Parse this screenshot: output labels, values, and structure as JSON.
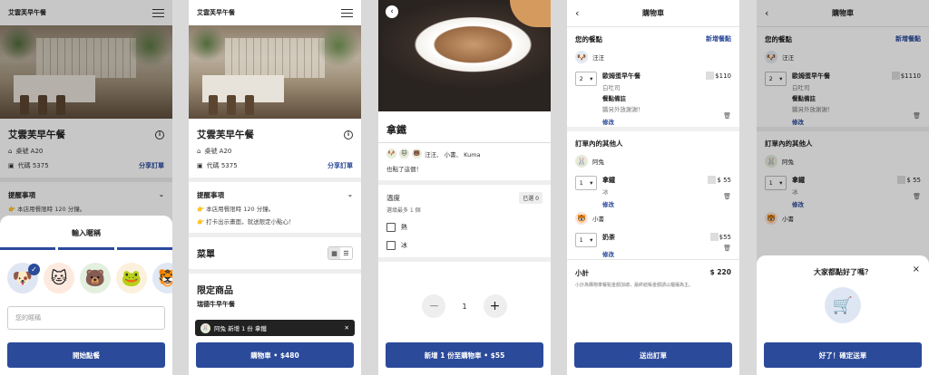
{
  "brand": "艾雲芙早午餐",
  "store": {
    "name": "艾雲芙早午餐",
    "table": "桌號 A20",
    "code": "代碼 5375",
    "share": "分享訂單",
    "info_glyph": "i"
  },
  "notice": {
    "title": "提醒事項",
    "line1": "👉 本店用餐限時 120 分鐘。",
    "line2": "👉 打卡出示畫面，就送限定小點心！"
  },
  "nickname_sheet": {
    "title": "輸入暱稱",
    "avatars": [
      "🐶",
      "🐱",
      "🐻",
      "🐸",
      "🐯"
    ],
    "placeholder": "您的暱稱",
    "start_button": "開始點餐"
  },
  "menu": {
    "title": "菜單",
    "section": "限定商品",
    "item": "瑞德牛早午餐",
    "toast": "阿兔 新增 1 份 拿鐵",
    "cart_button": "購物車 • $480"
  },
  "item": {
    "name": "拿鐵",
    "who": "汪汪、 小書、 Kuma",
    "also": "也點了這個！",
    "who_avatars": [
      "🐶",
      "🐱",
      "🐻"
    ],
    "option_title": "溫度",
    "option_hint": "選填最多 1 個",
    "option_badge": "已選 0",
    "options": [
      "熱",
      "冰"
    ],
    "qty": "1",
    "add_button": "新增 1 份至購物車 • $55"
  },
  "cart": {
    "title": "購物車",
    "your_items": "您的餐點",
    "add_items": "新增餐點",
    "me": "汪汪",
    "mine": {
      "qty": "2",
      "name": "歐姆蛋早午餐",
      "sub1": "白吐司",
      "sub2": "餐點備註",
      "sub3": "醬另外放謝謝！",
      "edit": "修改",
      "price": "$110"
    },
    "others_title": "訂單內的其他人",
    "others": [
      {
        "avatar": "🐰",
        "name": "阿兔",
        "qty": "1",
        "item": "拿鐵",
        "sub": "冰",
        "edit": "修改",
        "price": "$ 55"
      },
      {
        "avatar": "🐯",
        "name": "小書",
        "qty": "1",
        "item": "奶茶",
        "sub": "",
        "edit": "修改",
        "price": "$55"
      }
    ],
    "subtotal_label": "小計",
    "subtotal": "$ 220",
    "subnote": "小計為購物車餐點金額加總，最終結帳金額請以櫃檯為主。",
    "submit": "送出訂單"
  },
  "cart2": {
    "mine_price": "$1110",
    "other_price": "$ 55"
  },
  "confirm": {
    "title": "大家都點好了嗎？",
    "button": "好了！確定送單",
    "close": "×"
  }
}
